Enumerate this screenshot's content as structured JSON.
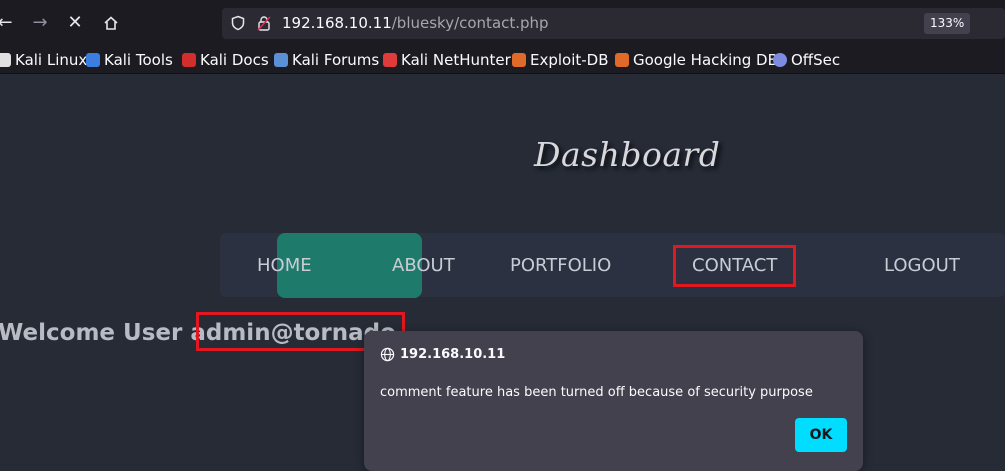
{
  "browser": {
    "url_host": "192.168.10.11",
    "url_path": "/bluesky/contact.php",
    "zoom": "133%",
    "bookmarks": [
      {
        "label": "Kali Linux",
        "icon": "kali-icon",
        "color": "#e0e0e0"
      },
      {
        "label": "Kali Tools",
        "icon": "kali-tools-icon",
        "color": "#3c7de0"
      },
      {
        "label": "Kali Docs",
        "icon": "kali-docs-icon",
        "color": "#d32e2e"
      },
      {
        "label": "Kali Forums",
        "icon": "kali-forums-icon",
        "color": "#5b8fd6"
      },
      {
        "label": "Kali NetHunter",
        "icon": "kali-nethunter-icon",
        "color": "#e03b3b"
      },
      {
        "label": "Exploit-DB",
        "icon": "exploit-db-icon",
        "color": "#e06a2a"
      },
      {
        "label": "Google Hacking DB",
        "icon": "ghdb-icon",
        "color": "#e06a2a"
      },
      {
        "label": "OffSec",
        "icon": "offsec-icon",
        "color": "#7d8ce0"
      }
    ]
  },
  "page": {
    "title": "Dashboard",
    "nav": [
      "HOME",
      "ABOUT",
      "PORTFOLIO",
      "CONTACT",
      "LOGOUT"
    ],
    "welcome": "Welcome User admin@tornado"
  },
  "dialog": {
    "origin": "192.168.10.11",
    "message": "comment feature has been turned off because of security purpose",
    "ok_label": "OK"
  },
  "colors": {
    "accent": "#00ddff",
    "nav_highlight": "#1e7b6b",
    "annotation": "#e1181f"
  }
}
